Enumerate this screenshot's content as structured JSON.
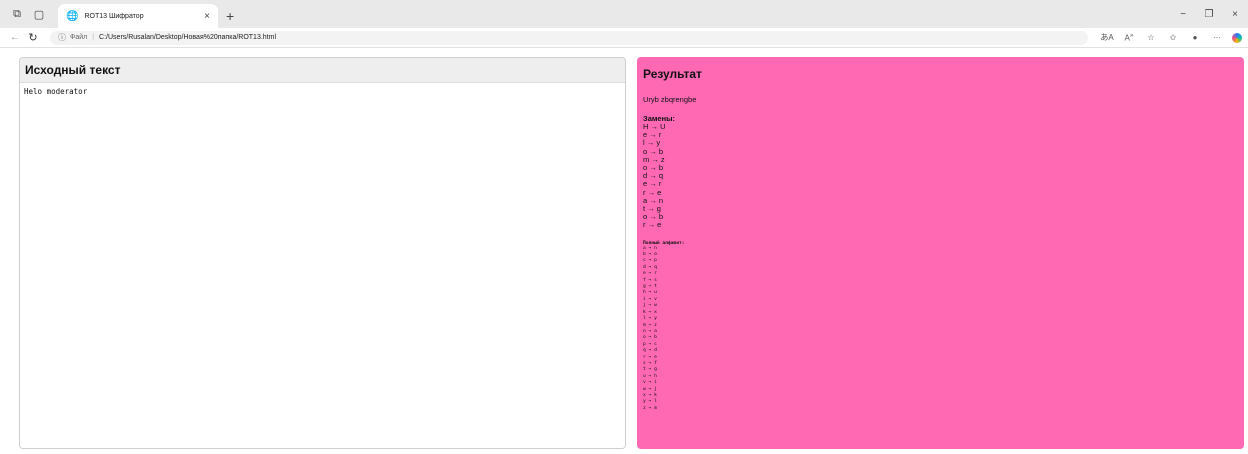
{
  "browser": {
    "tab_title": "ROT13 Шифратор",
    "tab_close": "×",
    "new_tab": "+",
    "url_prefix": "Файл",
    "url": "C:/Users/Rusalan/Desktop/Новая%20папка/ROT13.html",
    "window_controls": {
      "minimize": "−",
      "restore": "❐",
      "close": "×"
    },
    "toolbar_icons": [
      "translate-icon",
      "read-aloud-icon",
      "favorite-star-icon",
      "favorites-icon",
      "profile-icon",
      "more-icon",
      "copilot-icon"
    ]
  },
  "input_panel": {
    "title": "Исходный текст",
    "value": "Helo moderator"
  },
  "result_panel": {
    "title": "Результат",
    "result_text": "Uryb zbqrengbe",
    "substitutions_title": "Замены:",
    "substitutions": [
      "H → U",
      "e → r",
      "l → y",
      "o → b",
      "m → z",
      "o → b",
      "d → q",
      "e → r",
      "r → e",
      "a → n",
      "t → g",
      "o → b",
      "r → e"
    ],
    "alphabet_title": "Полный алфавит:",
    "alphabet": [
      "a → n",
      "b → o",
      "c → p",
      "d → q",
      "e → r",
      "f → s",
      "g → t",
      "h → u",
      "i → v",
      "j → w",
      "k → x",
      "l → y",
      "m → z",
      "n → a",
      "o → b",
      "p → c",
      "q → d",
      "r → e",
      "s → f",
      "t → g",
      "u → h",
      "v → i",
      "w → j",
      "x → k",
      "y → l",
      "z → m"
    ],
    "background_color": "#ff69b4"
  }
}
